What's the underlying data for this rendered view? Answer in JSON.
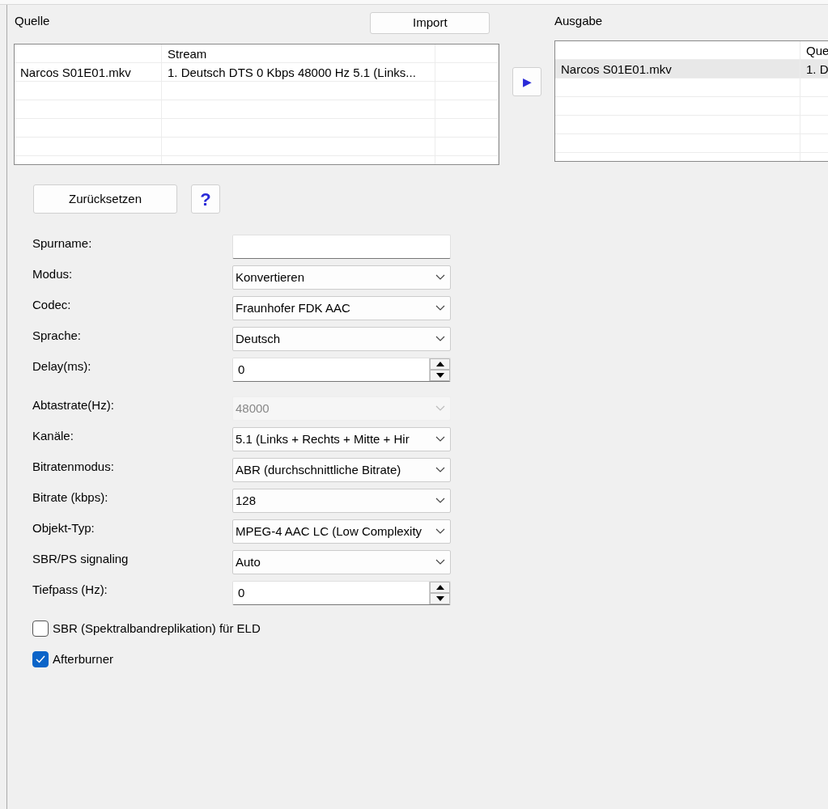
{
  "source": {
    "title": "Quelle",
    "import_button": "Import",
    "stream_header": "Stream",
    "rows": [
      {
        "file": "Narcos S01E01.mkv",
        "stream": "1. Deutsch DTS 0 Kbps 48000 Hz 5.1 (Links..."
      }
    ]
  },
  "add_button": "▶",
  "output": {
    "title": "Ausgabe",
    "column_2_header": "Que",
    "rows": [
      {
        "file": "Narcos S01E01.mkv",
        "column_2": "1. D",
        "selected": true
      }
    ]
  },
  "reset_button": "Zurücksetzen",
  "help_button": "?",
  "settings": [
    {
      "label": "Spurname:",
      "kind": "text",
      "disabled": false
    },
    {
      "label": "Modus:",
      "kind": "select",
      "value": "Konvertieren",
      "disabled": false
    },
    {
      "label": "Codec:",
      "kind": "select",
      "value": "Fraunhofer FDK AAC",
      "disabled": false
    },
    {
      "label": "Sprache:",
      "kind": "select",
      "value": "Deutsch",
      "disabled": false
    },
    {
      "label": "Delay(ms):",
      "kind": "spin",
      "value": "0",
      "disabled": false
    },
    {
      "label": "Abtastrate(Hz):",
      "kind": "select",
      "value": "48000",
      "disabled": true
    },
    {
      "label": "Kanäle:",
      "kind": "select",
      "value": "5.1 (Links + Rechts + Mitte + Hir",
      "disabled": false
    },
    {
      "label": "Bitratenmodus:",
      "kind": "select",
      "value": "ABR (durchschnittliche Bitrate)",
      "disabled": false
    },
    {
      "label": "Bitrate (kbps):",
      "kind": "select",
      "value": "128",
      "disabled": false
    },
    {
      "label": "Objekt-Typ:",
      "kind": "select",
      "value": "MPEG-4 AAC LC (Low Complexity",
      "disabled": false
    },
    {
      "label": "SBR/PS signaling",
      "kind": "select",
      "value": "Auto",
      "disabled": false
    },
    {
      "label": "Tiefpass (Hz):",
      "kind": "spin",
      "value": "0",
      "disabled": false
    }
  ],
  "options": [
    {
      "label": "SBR (Spektralbandreplikation) für ELD",
      "checked": false
    },
    {
      "label": "Afterburner",
      "checked": true
    }
  ]
}
